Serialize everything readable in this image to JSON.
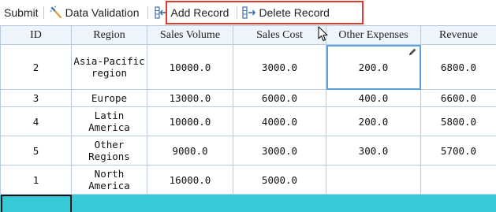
{
  "toolbar": {
    "submit_label": "Submit",
    "validation_label": "Data Validation",
    "add_label": "Add Record",
    "delete_label": "Delete Record",
    "icons": {
      "validation": "wand-icon",
      "add": "add-record-icon",
      "delete": "delete-record-icon"
    },
    "highlight_color": "#e03a2b"
  },
  "table": {
    "columns": [
      "ID",
      "Region",
      "Sales Volume",
      "Sales Cost",
      "Other Expenses",
      "Revenue"
    ],
    "rows": [
      {
        "id": "2",
        "region": "Asia-Pacific region",
        "sales_volume": "10000.0",
        "sales_cost": "3000.0",
        "other_expenses": "200.0",
        "revenue": "6800.0"
      },
      {
        "id": "3",
        "region": "Europe",
        "sales_volume": "13000.0",
        "sales_cost": "6000.0",
        "other_expenses": "400.0",
        "revenue": "6600.0"
      },
      {
        "id": "4",
        "region": "Latin America",
        "sales_volume": "10000.0",
        "sales_cost": "4000.0",
        "other_expenses": "200.0",
        "revenue": "5800.0"
      },
      {
        "id": "5",
        "region": "Other Regions",
        "sales_volume": "9000.0",
        "sales_cost": "3000.0",
        "other_expenses": "300.0",
        "revenue": "5700.0"
      },
      {
        "id": "1",
        "region": "North America",
        "sales_volume": "16000.0",
        "sales_cost": "5000.0",
        "other_expenses": "",
        "revenue": ""
      }
    ],
    "header_bg": "#eef4fb",
    "grid_color": "#b8cbe0",
    "new_row_color": "#36c9d6",
    "selected_color": "#5aa2dc"
  }
}
